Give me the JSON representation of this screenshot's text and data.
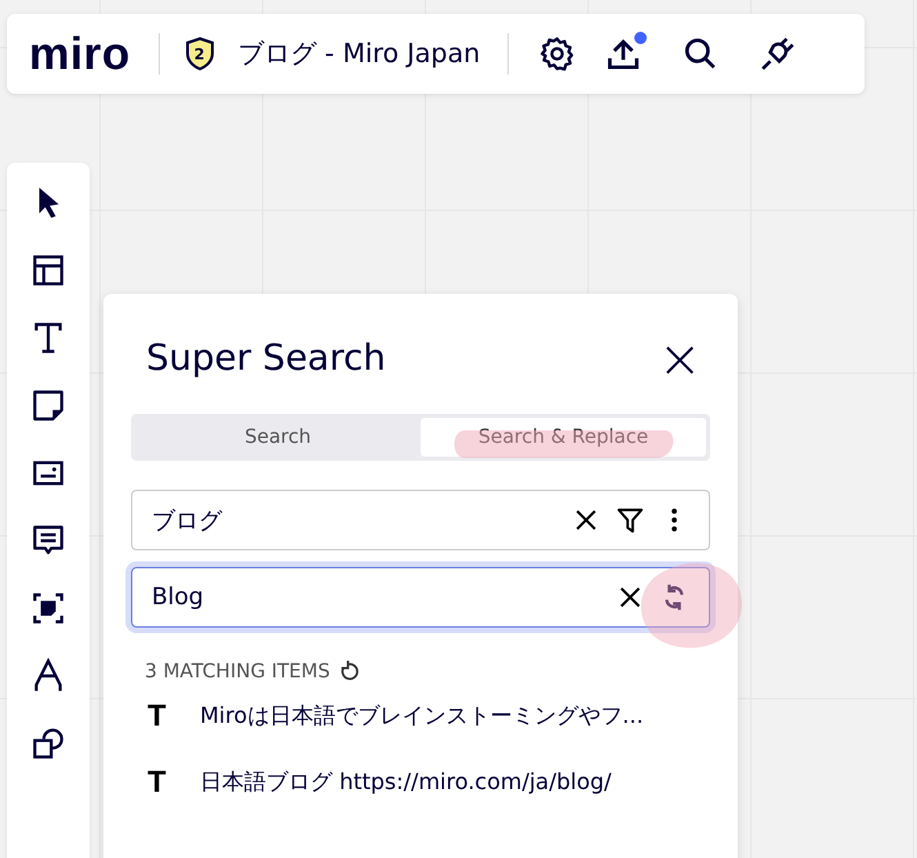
{
  "topbar": {
    "logo": "miro",
    "badge": "2",
    "board_title": "ブログ - Miro Japan",
    "upload_notification": true
  },
  "panel": {
    "title": "Super Search",
    "close": "×",
    "tabs": [
      {
        "label": "Search",
        "selected": false
      },
      {
        "label": "Search & Replace",
        "selected": true
      }
    ],
    "search_field": {
      "value": "ブログ"
    },
    "replace_field": {
      "value": "Blog",
      "focused": true
    },
    "results_count": "3 MATCHING ITEMS",
    "results": [
      {
        "icon": "T",
        "text": "Miroは日本語でブレインストーミングやフ..."
      },
      {
        "icon": "T",
        "text": "日本語ブログ https://miro.com/ja/blog/"
      }
    ]
  }
}
